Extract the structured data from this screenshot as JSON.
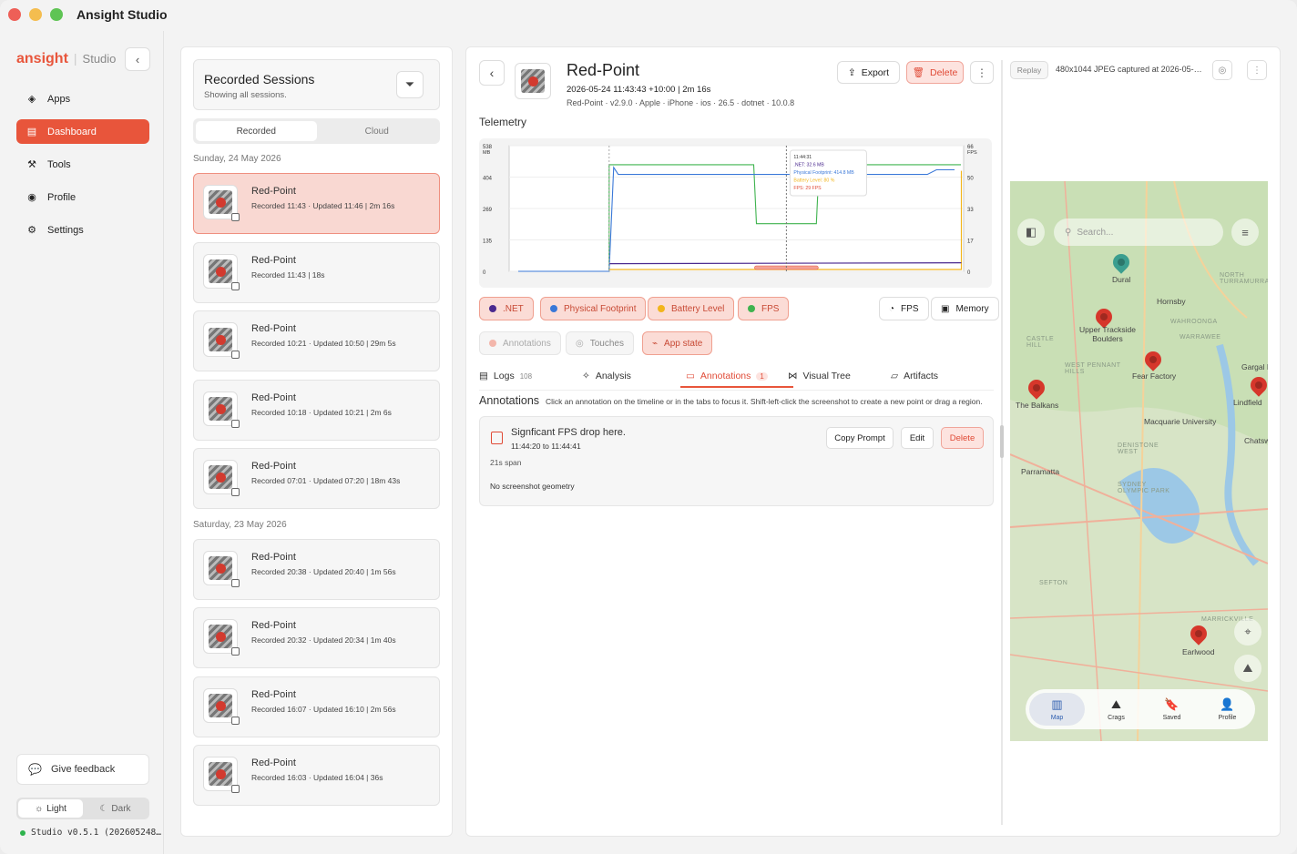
{
  "window": {
    "title": "Ansight Studio"
  },
  "sidebar": {
    "brand": "ansight",
    "product": "Studio",
    "nav": [
      {
        "label": "Apps",
        "icon": "cube-icon"
      },
      {
        "label": "Dashboard",
        "icon": "dashboard-icon",
        "active": true
      },
      {
        "label": "Tools",
        "icon": "wrench-icon"
      },
      {
        "label": "Profile",
        "icon": "person-icon"
      },
      {
        "label": "Settings",
        "icon": "gear-icon"
      }
    ],
    "feedback": "Give feedback",
    "theme": {
      "light": "Light",
      "dark": "Dark",
      "selected": "Light"
    },
    "version": "Studio v0.5.1 (202605248…"
  },
  "sessions": {
    "title": "Recorded Sessions",
    "subtitle": "Showing all sessions.",
    "tabs": [
      "Recorded",
      "Cloud"
    ],
    "groups": [
      {
        "date": "Sunday, 24 May 2026",
        "items": [
          {
            "name": "Red-Point",
            "meta": "Recorded 11:43 · Updated 11:46 | 2m 16s",
            "selected": true
          },
          {
            "name": "Red-Point",
            "meta": "Recorded 11:43 | 18s"
          },
          {
            "name": "Red-Point",
            "meta": "Recorded 10:21 · Updated 10:50 | 29m 5s"
          },
          {
            "name": "Red-Point",
            "meta": "Recorded 10:18 · Updated 10:21 | 2m 6s"
          },
          {
            "name": "Red-Point",
            "meta": "Recorded 07:01 · Updated 07:20 | 18m 43s"
          }
        ]
      },
      {
        "date": "Saturday, 23 May 2026",
        "items": [
          {
            "name": "Red-Point",
            "meta": "Recorded 20:38 · Updated 20:40 | 1m 56s"
          },
          {
            "name": "Red-Point",
            "meta": "Recorded 20:32 · Updated 20:34 | 1m 40s"
          },
          {
            "name": "Red-Point",
            "meta": "Recorded 16:07 · Updated 16:10 | 2m 56s"
          },
          {
            "name": "Red-Point",
            "meta": "Recorded 16:03 · Updated 16:04 | 36s"
          }
        ]
      }
    ]
  },
  "detail": {
    "title": "Red-Point",
    "date_line": "2026-05-24 11:43:43 +10:00  |  2m 16s",
    "meta_line": "Red-Point · v2.9.0 · Apple · iPhone · ios · 26.5 · dotnet · 10.0.8",
    "export": "Export",
    "delete": "Delete",
    "telemetry_label": "Telemetry",
    "legend_chips": [
      ".NET",
      "Physical Footprint",
      "Battery Level",
      "FPS"
    ],
    "axis_buttons": [
      "FPS",
      "Memory"
    ],
    "filter_chips": [
      "Annotations",
      "Touches",
      "App state"
    ],
    "tabs": [
      {
        "label": "Logs",
        "count": "108"
      },
      {
        "label": "Analysis"
      },
      {
        "label": "Annotations",
        "count": "1",
        "active": true
      },
      {
        "label": "Visual Tree"
      },
      {
        "label": "Artifacts"
      }
    ],
    "annotations_title": "Annotations",
    "annotations_hint": "Click an annotation on the timeline or in the tabs to focus it. Shift-left-click the screenshot to create a new point or drag a region.",
    "annotation": {
      "text": "Signficant FPS drop here.",
      "time": "11:44:20 to 11:44:41",
      "span": "21s span",
      "geometry": "No screenshot geometry",
      "copy": "Copy Prompt",
      "edit": "Edit",
      "delete": "Delete"
    }
  },
  "chart_data": {
    "type": "line",
    "left_axis": {
      "unit": "MB",
      "ticks": [
        "0",
        "135",
        "269",
        "404",
        "538"
      ]
    },
    "right_axis": {
      "unit": "FPS",
      "ticks": [
        "0",
        "17",
        "33",
        "50",
        "66"
      ]
    },
    "series": [
      {
        "name": ".NET",
        "color": "#4b2a8f",
        "values_mb": [
          0,
          32.6,
          32.6,
          32.6,
          32.6
        ]
      },
      {
        "name": "Physical Footprint",
        "color": "#3a78d8",
        "values_mb": [
          0,
          414.8,
          414.8,
          414.8,
          414.8
        ]
      },
      {
        "name": "Battery Level",
        "color": "#f2b51c",
        "values_pct": [
          0,
          80,
          80,
          80,
          80
        ]
      },
      {
        "name": "FPS",
        "color": "#3fb34f",
        "values_fps": [
          0,
          60,
          60,
          29,
          60
        ]
      }
    ],
    "tooltip": {
      "time": "11:44:31",
      "lines": [
        ".NET: 32.6 MB",
        "Physical Footprint: 414.8 MB",
        "Battery Level: 80 %",
        "FPS: 29 FPS"
      ]
    },
    "annotation_range": [
      "11:44:20",
      "11:44:41"
    ],
    "grid": true
  },
  "replay": {
    "button": "Replay",
    "info": "480x1044 JPEG captured at 2026-05-2…",
    "map": {
      "search_placeholder": "Search...",
      "places": [
        "Dural",
        "Hornsby",
        "Upper Trackside Boulders",
        "Fear Factory",
        "The Balkans",
        "Lindfield",
        "Macquarie University",
        "Parramatta",
        "Earlwood",
        "Chatsw",
        "Gargal Nat"
      ],
      "regions": [
        "NORTH TURRAMURRA",
        "WAHROONGA",
        "WARRAWEE",
        "CASTLE HILL",
        "WEST PENNANT HILLS",
        "DENISTONE WEST",
        "SYDNEY OLYMPIC PARK",
        "SEFTON",
        "MARRICKVILLE"
      ],
      "nav": [
        "Map",
        "Crags",
        "Saved",
        "Profile"
      ]
    }
  }
}
